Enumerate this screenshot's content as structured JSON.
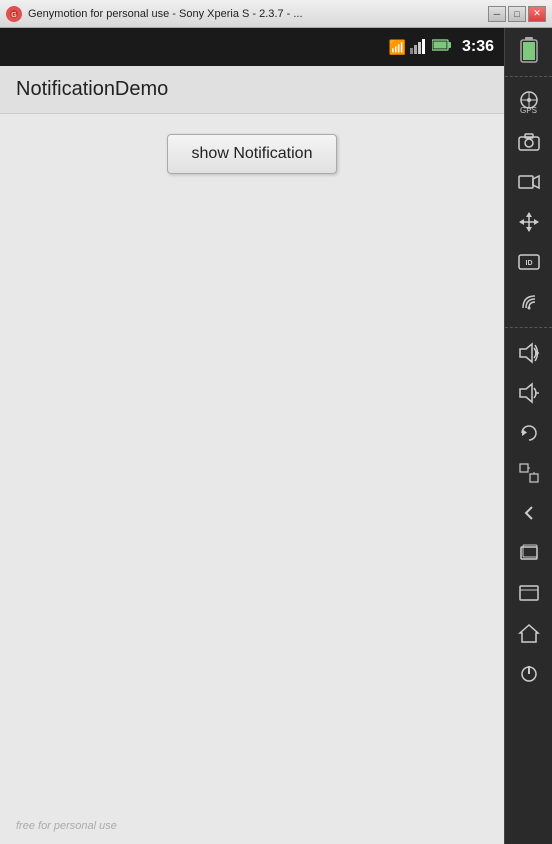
{
  "window": {
    "title": "Genymotion for personal use - Sony Xperia S - 2.3.7 - ...",
    "minimize_label": "─",
    "restore_label": "□",
    "close_label": "✕"
  },
  "status_bar": {
    "time": "3:36"
  },
  "app": {
    "title": "NotificationDemo",
    "show_notification_button": "show Notification"
  },
  "watermark": {
    "text": "free for personal use"
  },
  "sidebar": {
    "gps_label": "GPS",
    "volume_up_icon": "🔊",
    "volume_down_icon": "🔉",
    "back_icon": "↩",
    "home_icon": "⌂",
    "menu_icon": "☰",
    "power_icon": "⏻"
  }
}
